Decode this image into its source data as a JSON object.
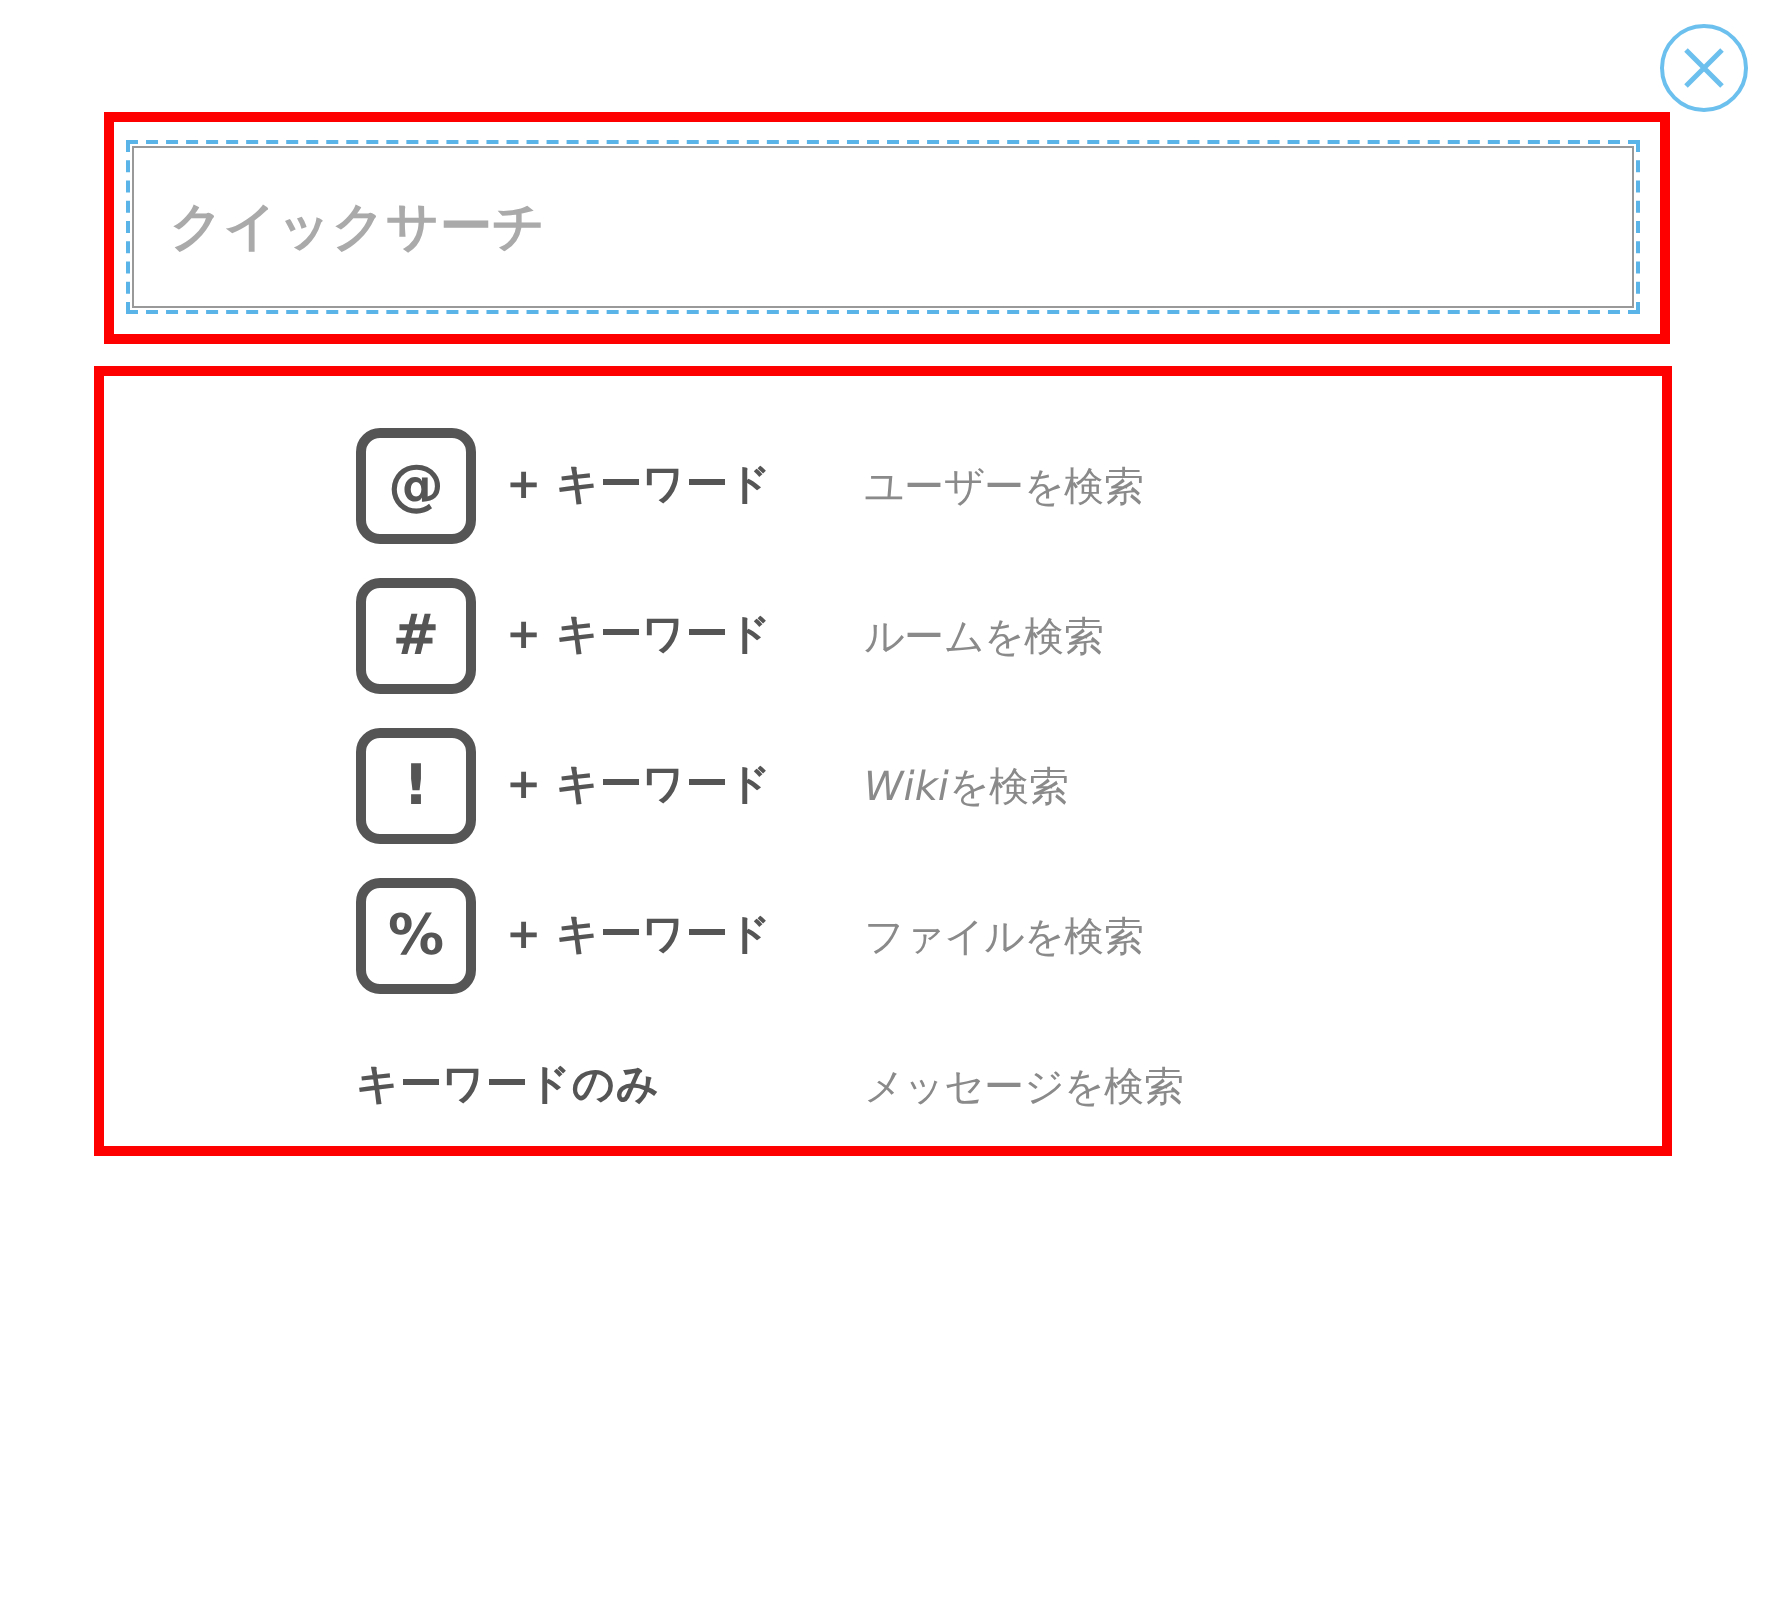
{
  "search": {
    "placeholder": "クイックサーチ"
  },
  "hints": [
    {
      "kind": "key",
      "key": "@",
      "keyword": "+ キーワード",
      "description": "ユーザーを検索"
    },
    {
      "kind": "key",
      "key": "#",
      "keyword": "+ キーワード",
      "description": "ルームを検索"
    },
    {
      "kind": "key",
      "key": "!",
      "keyword": "+ キーワード",
      "description": [
        {
          "text": "Wiki",
          "italic": true
        },
        {
          "text": "を検索",
          "italic": false
        }
      ]
    },
    {
      "kind": "key",
      "key": "%",
      "keyword": "+ キーワード",
      "description": "ファイルを検索"
    },
    {
      "kind": "plain",
      "keyword": "キーワードのみ",
      "description": "メッセージを検索"
    }
  ]
}
